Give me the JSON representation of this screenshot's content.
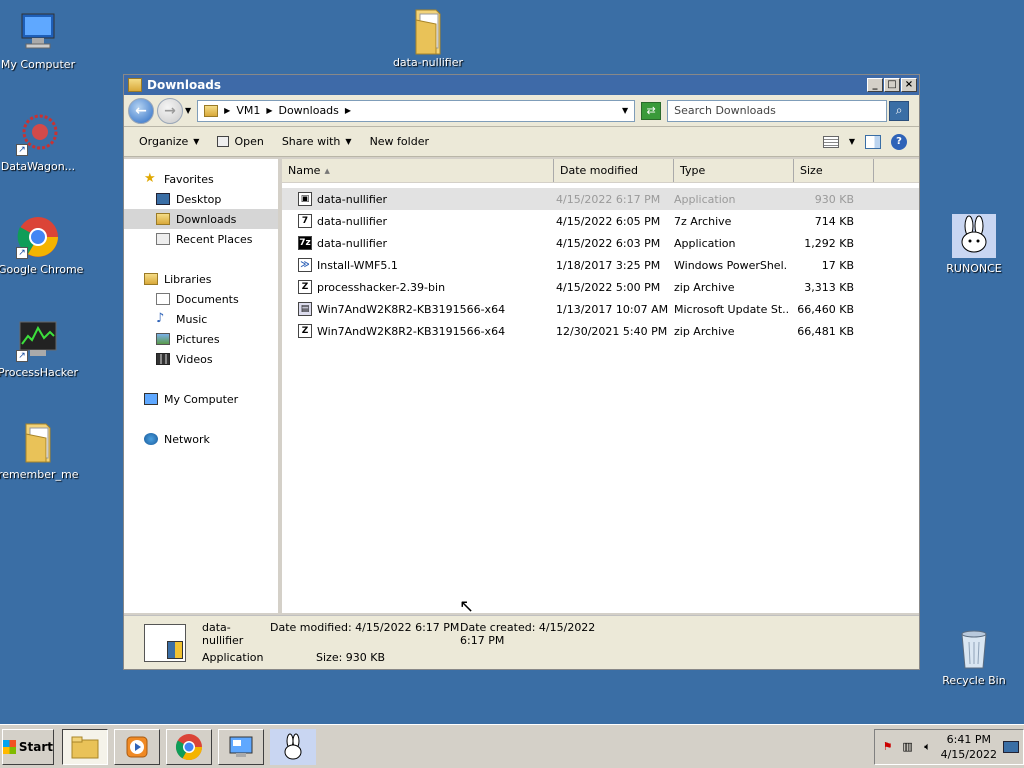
{
  "desktop": {
    "icons": [
      {
        "label": "My Computer",
        "icon": "computer-icon"
      },
      {
        "label": "DataWagon...",
        "icon": "datawagon-icon"
      },
      {
        "label": "Google Chrome",
        "icon": "chrome-icon"
      },
      {
        "label": "ProcessHacker",
        "icon": "processhacker-icon"
      },
      {
        "label": "remember_me",
        "icon": "folder-icon"
      },
      {
        "label": "data-nullifier",
        "icon": "folder-icon"
      },
      {
        "label": "RUNONCE",
        "icon": "bunny-icon"
      },
      {
        "label": "Recycle Bin",
        "icon": "recycle-bin-icon"
      }
    ]
  },
  "window": {
    "title": "Downloads",
    "breadcrumb": [
      "VM1",
      "Downloads"
    ],
    "search_placeholder": "Search Downloads",
    "toolbar": {
      "organize": "Organize",
      "open": "Open",
      "share_with": "Share with",
      "new_folder": "New folder"
    },
    "nav": {
      "favorites": "Favorites",
      "desktop": "Desktop",
      "downloads": "Downloads",
      "recent_places": "Recent Places",
      "libraries": "Libraries",
      "documents": "Documents",
      "music": "Music",
      "pictures": "Pictures",
      "videos": "Videos",
      "my_computer": "My Computer",
      "network": "Network"
    },
    "columns": {
      "name": "Name",
      "date": "Date modified",
      "type": "Type",
      "size": "Size"
    },
    "files": [
      {
        "name": "data-nullifier",
        "date": "4/15/2022 6:17 PM",
        "type": "Application",
        "size": "930 KB",
        "icon": "app-icon"
      },
      {
        "name": "data-nullifier",
        "date": "4/15/2022 6:05 PM",
        "type": "7z Archive",
        "size": "714 KB",
        "icon": "archive-icon"
      },
      {
        "name": "data-nullifier",
        "date": "4/15/2022 6:03 PM",
        "type": "Application",
        "size": "1,292 KB",
        "icon": "7z-app-icon"
      },
      {
        "name": "Install-WMF5.1",
        "date": "1/18/2017 3:25 PM",
        "type": "Windows PowerShel...",
        "size": "17 KB",
        "icon": "powershell-icon"
      },
      {
        "name": "processhacker-2.39-bin",
        "date": "4/15/2022 5:00 PM",
        "type": "zip Archive",
        "size": "3,313 KB",
        "icon": "zip-icon"
      },
      {
        "name": "Win7AndW2K8R2-KB3191566-x64",
        "date": "1/13/2017 10:07 AM",
        "type": "Microsoft Update St...",
        "size": "66,460 KB",
        "icon": "msu-icon"
      },
      {
        "name": "Win7AndW2K8R2-KB3191566-x64",
        "date": "12/30/2021 5:40 PM",
        "type": "zip Archive",
        "size": "66,481 KB",
        "icon": "zip-icon"
      }
    ],
    "details": {
      "name": "data-nullifier",
      "kind": "Application",
      "date_modified_label": "Date modified:",
      "date_modified": "4/15/2022 6:17 PM",
      "date_created_label": "Date created:",
      "date_created": "4/15/2022 6:17 PM",
      "size_label": "Size:",
      "size": "930 KB"
    }
  },
  "taskbar": {
    "start": "Start",
    "time": "6:41 PM",
    "date": "4/15/2022"
  }
}
